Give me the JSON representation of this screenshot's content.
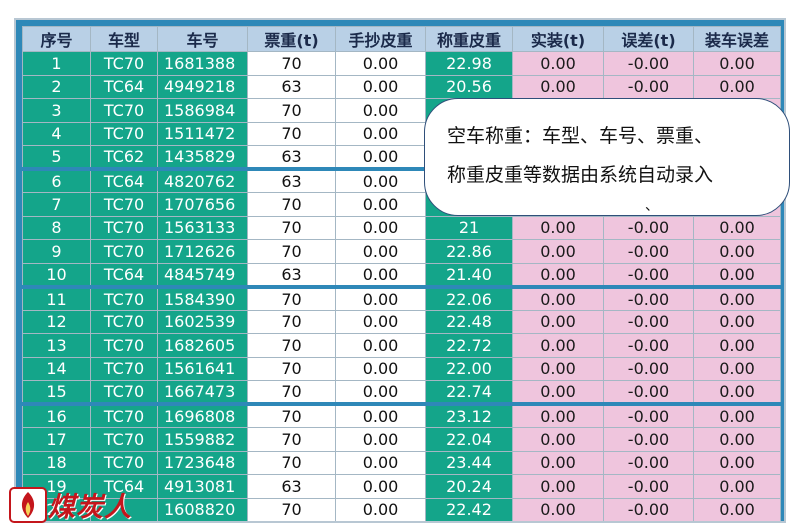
{
  "columns": [
    "序号",
    "车型",
    "车号",
    "票重(t)",
    "手抄皮重",
    "称重皮重",
    "实装(t)",
    "误差(t)",
    "装车误差"
  ],
  "rows": [
    [
      "1",
      "TC70",
      "1681388",
      "70",
      "0.00",
      "22.98",
      "0.00",
      "-0.00",
      "0.00"
    ],
    [
      "2",
      "TC64",
      "4949218",
      "63",
      "0.00",
      "20.56",
      "0.00",
      "-0.00",
      "0.00"
    ],
    [
      "3",
      "TC70",
      "1586984",
      "70",
      "0.00",
      "",
      "",
      "",
      ""
    ],
    [
      "4",
      "TC70",
      "1511472",
      "70",
      "0.00",
      "",
      "",
      "",
      ""
    ],
    [
      "5",
      "TC62",
      "1435829",
      "63",
      "0.00",
      "",
      "",
      "",
      ""
    ],
    [
      "6",
      "TC64",
      "4820762",
      "63",
      "0.00",
      "",
      "",
      "",
      ""
    ],
    [
      "7",
      "TC70",
      "1707656",
      "70",
      "0.00",
      "",
      "",
      "",
      ""
    ],
    [
      "8",
      "TC70",
      "1563133",
      "70",
      "0.00",
      "21",
      "0.00",
      "-0.00",
      "0.00"
    ],
    [
      "9",
      "TC70",
      "1712626",
      "70",
      "0.00",
      "22.86",
      "0.00",
      "-0.00",
      "0.00"
    ],
    [
      "10",
      "TC64",
      "4845749",
      "63",
      "0.00",
      "21.40",
      "0.00",
      "-0.00",
      "0.00"
    ],
    [
      "11",
      "TC70",
      "1584390",
      "70",
      "0.00",
      "22.06",
      "0.00",
      "-0.00",
      "0.00"
    ],
    [
      "12",
      "TC70",
      "1602539",
      "70",
      "0.00",
      "22.48",
      "0.00",
      "-0.00",
      "0.00"
    ],
    [
      "13",
      "TC70",
      "1682605",
      "70",
      "0.00",
      "22.72",
      "0.00",
      "-0.00",
      "0.00"
    ],
    [
      "14",
      "TC70",
      "1561641",
      "70",
      "0.00",
      "22.00",
      "0.00",
      "-0.00",
      "0.00"
    ],
    [
      "15",
      "TC70",
      "1667473",
      "70",
      "0.00",
      "22.74",
      "0.00",
      "-0.00",
      "0.00"
    ],
    [
      "16",
      "TC70",
      "1696808",
      "70",
      "0.00",
      "23.12",
      "0.00",
      "-0.00",
      "0.00"
    ],
    [
      "17",
      "TC70",
      "1559882",
      "70",
      "0.00",
      "22.04",
      "0.00",
      "-0.00",
      "0.00"
    ],
    [
      "18",
      "TC70",
      "1723648",
      "70",
      "0.00",
      "23.44",
      "0.00",
      "-0.00",
      "0.00"
    ],
    [
      "19",
      "TC64",
      "4913081",
      "63",
      "0.00",
      "20.24",
      "0.00",
      "-0.00",
      "0.00"
    ],
    [
      "20",
      "",
      "1608820",
      "70",
      "0.00",
      "22.42",
      "0.00",
      "-0.00",
      "0.00"
    ]
  ],
  "callout": {
    "line1": "空车称重：车型、车号、票重、",
    "line2": "称重皮重等数据由系统自动录入",
    "mark": "、"
  },
  "watermark": {
    "text": "煤炭人"
  },
  "colors": {
    "frame": "#2e88b8",
    "header": "#b9d0e6",
    "green_cells": "#14a58a",
    "pink_cells": "#efc5dd",
    "white_cells": "#ffffff",
    "logo_red": "#c4161c"
  }
}
